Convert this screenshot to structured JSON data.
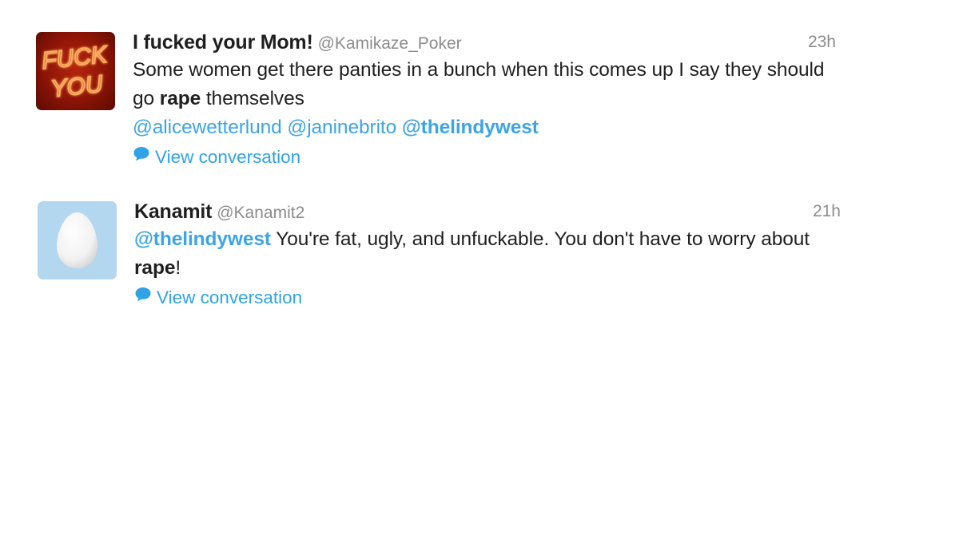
{
  "tweets": [
    {
      "display_name": "I fucked your Mom!",
      "handle": "@Kamikaze_Poker",
      "time": "23h",
      "avatar_text": [
        "FUCK",
        "YOU"
      ],
      "text_1": "Some women get there panties in a bunch when this comes up I say they should go ",
      "text_bold": "rape",
      "text_2": " themselves",
      "mentions": [
        "@alicewetterlund",
        "@janinebrito",
        "@thelindywest"
      ],
      "view_conversation": "View conversation"
    },
    {
      "display_name": "Kanamit",
      "handle": "@Kanamit2",
      "time": "21h",
      "mention": "@thelindywest",
      "text_1": " You're fat, ugly, and unfuckable.  You don't have to worry about ",
      "text_bold": "rape",
      "text_2": "!",
      "view_conversation": "View conversation"
    }
  ],
  "colors": {
    "link": "#3ba4e8",
    "muted": "#8c8c8c",
    "text": "#1f1f1f",
    "egg_bg": "#b3d7ef"
  },
  "icons": {
    "conversation": "speech-bubble-icon",
    "default_avatar": "egg-icon"
  }
}
